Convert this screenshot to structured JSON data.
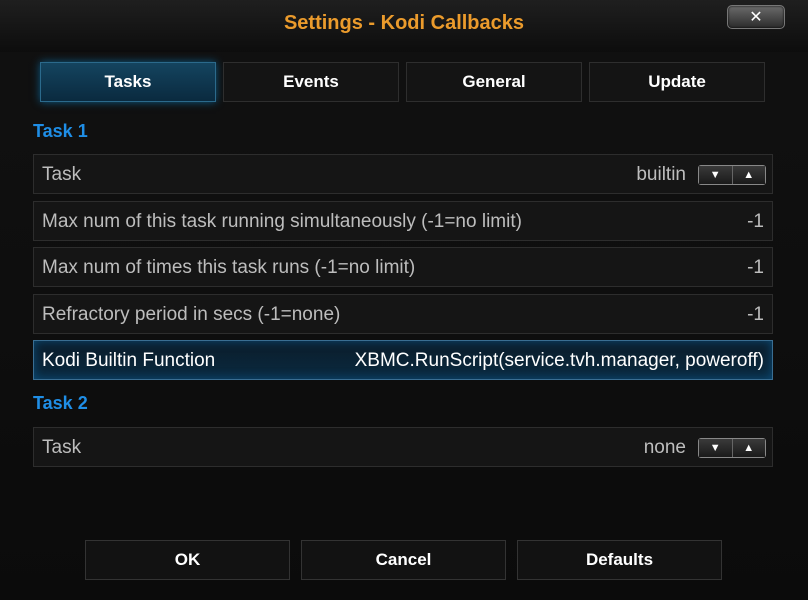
{
  "window": {
    "title": "Settings - Kodi Callbacks",
    "close_label": "✕"
  },
  "tabs": [
    {
      "label": "Tasks",
      "active": true
    },
    {
      "label": "Events",
      "active": false
    },
    {
      "label": "General",
      "active": false
    },
    {
      "label": "Update",
      "active": false
    }
  ],
  "task1": {
    "title": "Task 1",
    "rows": [
      {
        "label": "Task",
        "value": "builtin",
        "control": "spinner"
      },
      {
        "label": "Max num of this task running simultaneously (-1=no limit)",
        "value": "-1"
      },
      {
        "label": "Max num of times this task runs (-1=no limit)",
        "value": "-1"
      },
      {
        "label": "Refractory period in secs (-1=none)",
        "value": "-1"
      },
      {
        "label": "Kodi Builtin Function",
        "value": "XBMC.RunScript(service.tvh.manager, poweroff)",
        "focused": true
      }
    ]
  },
  "task2": {
    "title": "Task 2",
    "rows": [
      {
        "label": "Task",
        "value": "none",
        "control": "spinner"
      }
    ]
  },
  "spinner": {
    "down": "▼",
    "up": "▲"
  },
  "buttons": {
    "ok": "OK",
    "cancel": "Cancel",
    "defaults": "Defaults"
  },
  "colors": {
    "title": "#eb9b2c",
    "section": "#1f8ee6",
    "focus": "#3a6e92"
  }
}
